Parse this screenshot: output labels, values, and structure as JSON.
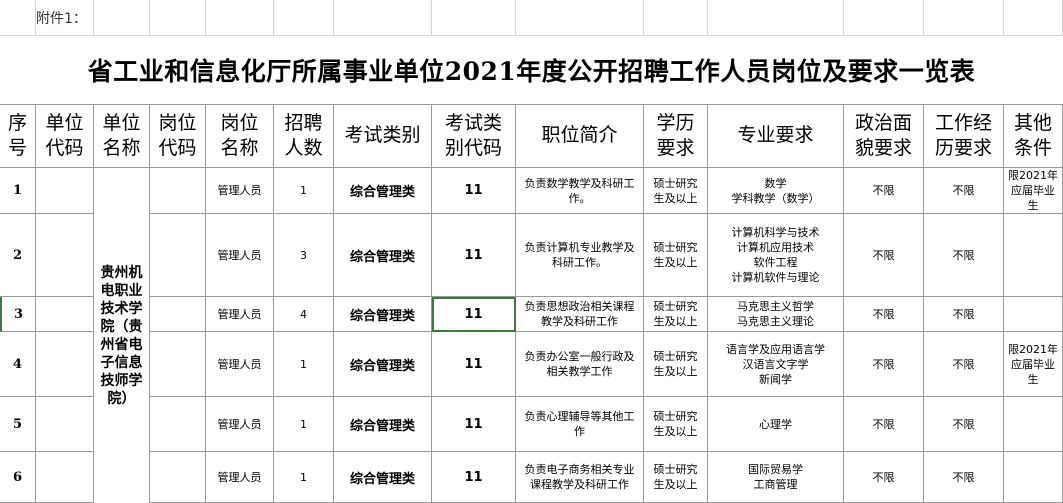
{
  "annex_label": "附件1：",
  "title": "省工业和信息化厅所属事业单位2021年度公开招聘工作人员岗位及要求一览表",
  "headers": {
    "seq": "序\n号",
    "unit_code": "单位\n代码",
    "unit_name": "单位\n名称",
    "post_code": "岗位\n代码",
    "post_name": "岗位\n名称",
    "count": "招聘\n人数",
    "exam_type": "考试类别",
    "exam_code": "考试类\n别代码",
    "intro": "职位简介",
    "education": "学历\n要求",
    "major": "专业要求",
    "political": "政治面\n貌要求",
    "experience": "工作经\n历要求",
    "other": "其他\n条件"
  },
  "unit_name": "贵州机电职业技术学院（贵州省电子信息技师学院）",
  "rows": [
    {
      "seq": "1",
      "post_name": "管理人员",
      "count": "1",
      "exam_type": "综合管理类",
      "exam_code": "11",
      "intro": "负责数学教学及科研工作。",
      "education": "硕士研究生及以上",
      "major": "数学\n学科教学（数学）",
      "political": "不限",
      "experience": "不限",
      "other": "限2021年应届毕业生"
    },
    {
      "seq": "2",
      "post_name": "管理人员",
      "count": "3",
      "exam_type": "综合管理类",
      "exam_code": "11",
      "intro": "负责计算机专业教学及科研工作。",
      "education": "硕士研究生及以上",
      "major": "计算机科学与技术\n计算机应用技术\n软件工程\n计算机软件与理论",
      "political": "不限",
      "experience": "不限",
      "other": ""
    },
    {
      "seq": "3",
      "post_name": "管理人员",
      "count": "4",
      "exam_type": "综合管理类",
      "exam_code": "11",
      "intro": "负责思想政治相关课程教学及科研工作",
      "education": "硕士研究生及以上",
      "major": "马克思主义哲学\n马克思主义理论",
      "political": "不限",
      "experience": "不限",
      "other": ""
    },
    {
      "seq": "4",
      "post_name": "管理人员",
      "count": "1",
      "exam_type": "综合管理类",
      "exam_code": "11",
      "intro": "负责办公室一般行政及相关教学工作",
      "education": "硕士研究生及以上",
      "major": "语言学及应用语言学\n汉语言文字学\n新闻学",
      "political": "不限",
      "experience": "不限",
      "other": "限2021年应届毕业生"
    },
    {
      "seq": "5",
      "post_name": "管理人员",
      "count": "1",
      "exam_type": "综合管理类",
      "exam_code": "11",
      "intro": "负责心理辅导等其他工作",
      "education": "硕士研究生及以上",
      "major": "心理学",
      "political": "不限",
      "experience": "不限",
      "other": ""
    },
    {
      "seq": "6",
      "post_name": "管理人员",
      "count": "1",
      "exam_type": "综合管理类",
      "exam_code": "11",
      "intro": "负责电子商务相关专业课程教学及科研工作",
      "education": "硕士研究生及以上",
      "major": "国际贸易学\n工商管理",
      "political": "不限",
      "experience": "不限",
      "other": ""
    }
  ],
  "colors": {
    "grid": "#9a9a9a",
    "selection": "#3b7b3b",
    "light_grid": "#d4d4d4"
  }
}
